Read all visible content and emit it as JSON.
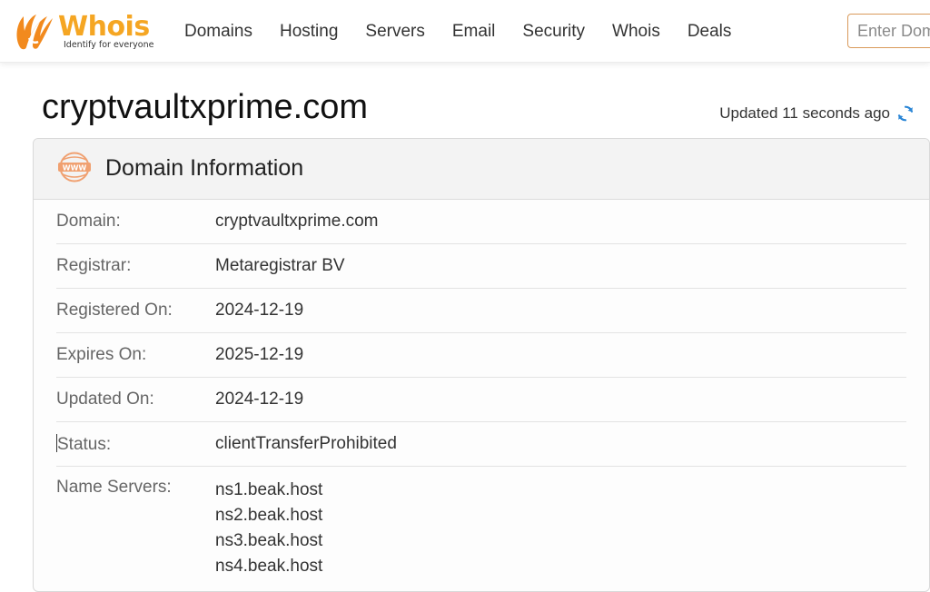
{
  "brand": {
    "name": "Whois",
    "tagline": "Identify for everyone",
    "accent_color": "#f5a623",
    "icon": "whois-logo-icon"
  },
  "nav": {
    "items": [
      {
        "label": "Domains"
      },
      {
        "label": "Hosting"
      },
      {
        "label": "Servers"
      },
      {
        "label": "Email"
      },
      {
        "label": "Security"
      },
      {
        "label": "Whois"
      },
      {
        "label": "Deals"
      }
    ]
  },
  "search": {
    "placeholder": "Enter Domain",
    "value": ""
  },
  "page": {
    "title": "cryptvaultxprime.com",
    "updated_text": "Updated 11 seconds ago",
    "refresh_icon": "refresh-icon",
    "refresh_color": "#2b86d6"
  },
  "domain_info": {
    "heading": "Domain Information",
    "icon": "www-icon",
    "rows": [
      {
        "label": "Domain:",
        "value": "cryptvaultxprime.com"
      },
      {
        "label": "Registrar:",
        "value": "Metaregistrar BV"
      },
      {
        "label": "Registered On:",
        "value": "2024-12-19"
      },
      {
        "label": "Expires On:",
        "value": "2025-12-19"
      },
      {
        "label": "Updated On:",
        "value": "2024-12-19"
      },
      {
        "label": "Status:",
        "value": "clientTransferProhibited"
      }
    ],
    "name_servers": {
      "label": "Name Servers:",
      "values": [
        "ns1.beak.host",
        "ns2.beak.host",
        "ns3.beak.host",
        "ns4.beak.host"
      ]
    }
  }
}
